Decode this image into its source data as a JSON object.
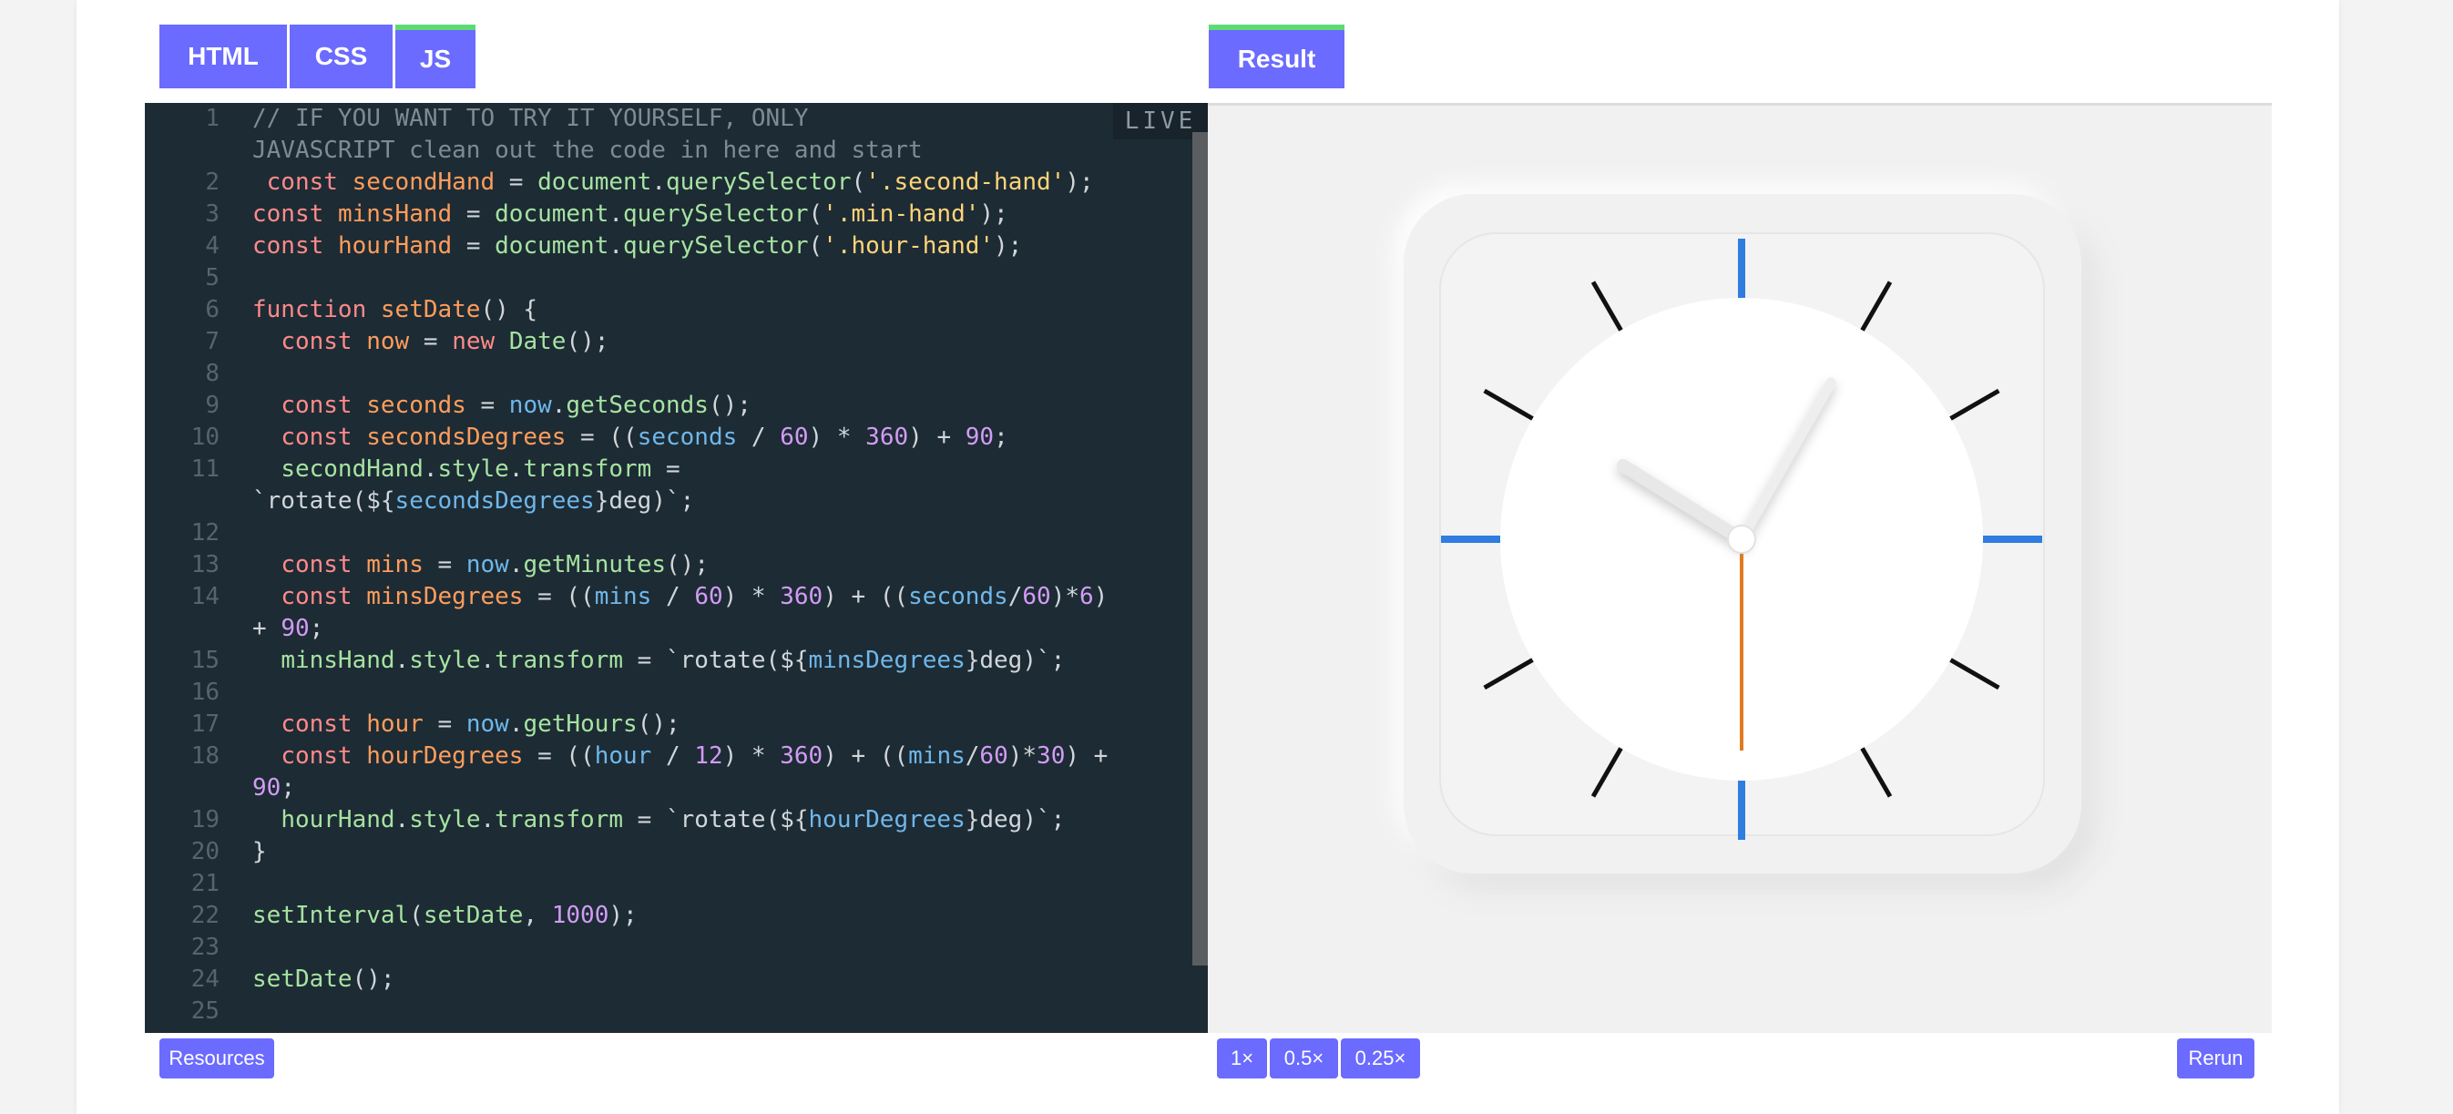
{
  "tabs": {
    "html": "HTML",
    "css": "CSS",
    "js": "JS",
    "result": "Result"
  },
  "live_label": "LIVE",
  "code_lines": [
    {
      "n": "1",
      "t": "// IF YOU WANT TO TRY IT YOURSELF, ONLY"
    },
    {
      "n": "",
      "t": "JAVASCRIPT clean out the code in here and start"
    },
    {
      "n": "2",
      "t": " const secondHand = document.querySelector('.second-hand');"
    },
    {
      "n": "3",
      "t": "const minsHand = document.querySelector('.min-hand');"
    },
    {
      "n": "4",
      "t": "const hourHand = document.querySelector('.hour-hand');"
    },
    {
      "n": "5",
      "t": ""
    },
    {
      "n": "6",
      "t": "function setDate() {"
    },
    {
      "n": "7",
      "t": "  const now = new Date();"
    },
    {
      "n": "8",
      "t": ""
    },
    {
      "n": "9",
      "t": "  const seconds = now.getSeconds();"
    },
    {
      "n": "10",
      "t": "  const secondsDegrees = ((seconds / 60) * 360) + 90;"
    },
    {
      "n": "11",
      "t": "  secondHand.style.transform ="
    },
    {
      "n": "",
      "t": "`rotate(${secondsDegrees}deg)`;"
    },
    {
      "n": "12",
      "t": ""
    },
    {
      "n": "13",
      "t": "  const mins = now.getMinutes();"
    },
    {
      "n": "14",
      "t": "  const minsDegrees = ((mins / 60) * 360) + ((seconds/60)*6)"
    },
    {
      "n": "",
      "t": "+ 90;"
    },
    {
      "n": "15",
      "t": "  minsHand.style.transform = `rotate(${minsDegrees}deg)`;"
    },
    {
      "n": "16",
      "t": ""
    },
    {
      "n": "17",
      "t": "  const hour = now.getHours();"
    },
    {
      "n": "18",
      "t": "  const hourDegrees = ((hour / 12) * 360) + ((mins/60)*30) +"
    },
    {
      "n": "",
      "t": "90;"
    },
    {
      "n": "19",
      "t": "  hourHand.style.transform = `rotate(${hourDegrees}deg)`;"
    },
    {
      "n": "20",
      "t": "}"
    },
    {
      "n": "21",
      "t": ""
    },
    {
      "n": "22",
      "t": "setInterval(setDate, 1000);"
    },
    {
      "n": "23",
      "t": ""
    },
    {
      "n": "24",
      "t": "setDate();"
    },
    {
      "n": "25",
      "t": ""
    }
  ],
  "footer": {
    "resources": "Resources",
    "zoom_1x": "1×",
    "zoom_05x": "0.5×",
    "zoom_025x": "0.25×",
    "rerun": "Rerun"
  },
  "colors": {
    "accent": "#6b6bff",
    "active_tab_indicator": "#5cdb74",
    "editor_bg": "#1d2b34",
    "clock_tick_blue": "#2f7de1",
    "second_hand": "#e07b22"
  }
}
